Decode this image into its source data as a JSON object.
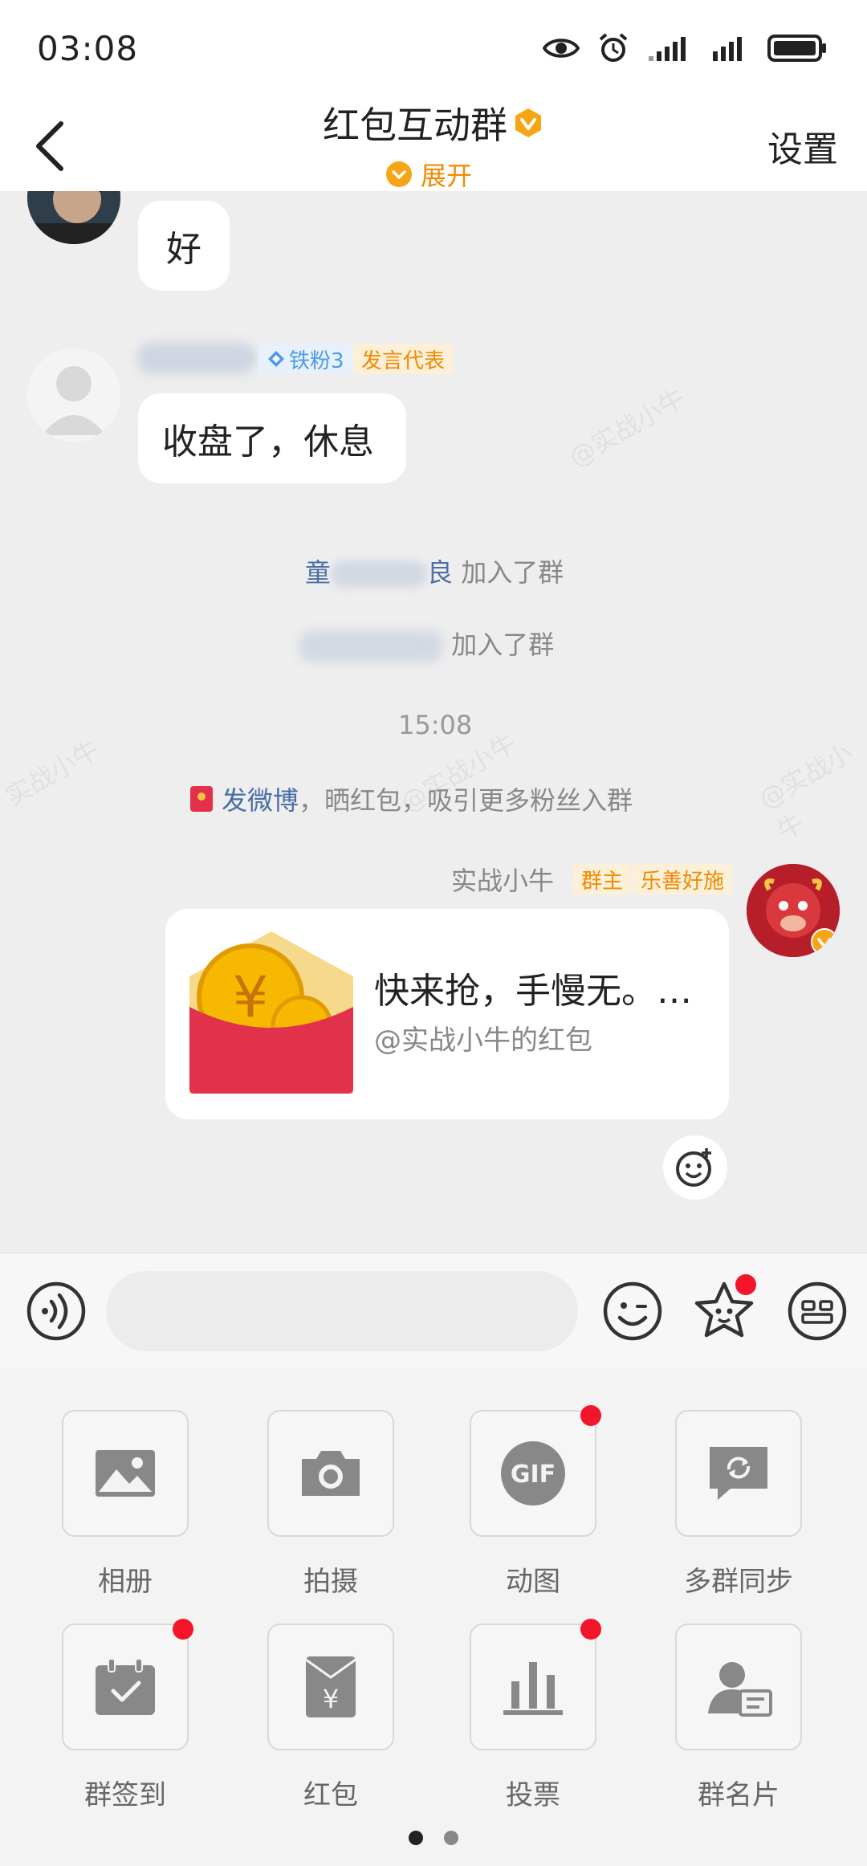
{
  "status_bar": {
    "time": "03:08"
  },
  "nav": {
    "title": "红包互动群",
    "expand_label": "展开",
    "settings_label": "设置"
  },
  "messages": {
    "msg1_text": "好",
    "msg2_badge_fan": "铁粉3",
    "msg2_badge_role": "发言代表",
    "msg2_text": "收盘了，休息",
    "join1_prefix": "童",
    "join1_suffix": "良",
    "join1_text": "加入了群",
    "join2_text": "加入了群",
    "timestamp": "15:08",
    "promo_link": "发微博",
    "promo_text": "，晒红包，吸引更多粉丝入群",
    "sender_name": "实战小牛",
    "sender_badge_owner": "群主",
    "sender_badge_charity": "乐善好施",
    "redpacket_title": "快来抢，手慢无。…",
    "redpacket_sub": "@实战小牛的红包"
  },
  "watermarks": [
    "@实战小牛",
    "@实战小牛",
    "实战小牛",
    "@实战小牛"
  ],
  "tools": [
    {
      "label": "相册",
      "icon": "album-icon",
      "dot": false
    },
    {
      "label": "拍摄",
      "icon": "camera-icon",
      "dot": false
    },
    {
      "label": "动图",
      "icon": "gif-icon",
      "dot": true
    },
    {
      "label": "多群同步",
      "icon": "multi-group-sync-icon",
      "dot": false
    },
    {
      "label": "群签到",
      "icon": "group-checkin-icon",
      "dot": true
    },
    {
      "label": "红包",
      "icon": "red-packet-icon",
      "dot": false
    },
    {
      "label": "投票",
      "icon": "vote-icon",
      "dot": true
    },
    {
      "label": "群名片",
      "icon": "group-card-icon",
      "dot": false
    }
  ],
  "gif_text": "GIF",
  "colors": {
    "accent_orange": "#f08a00",
    "red_dot": "#f3152a",
    "link_blue": "#4a6fa5",
    "red_packet": "#e2314a",
    "coin_yellow": "#f6b800"
  }
}
